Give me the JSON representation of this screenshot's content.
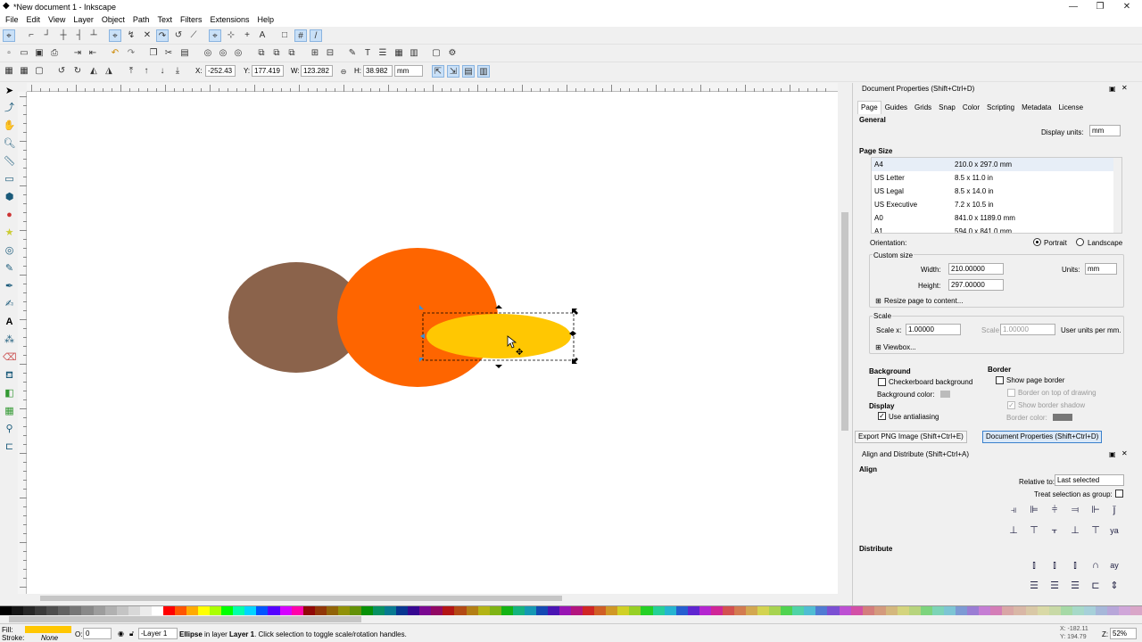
{
  "window": {
    "title": "*New document 1 - Inkscape",
    "minimize": "—",
    "maximize": "❐",
    "close": "✕"
  },
  "menu": [
    "File",
    "Edit",
    "View",
    "Layer",
    "Object",
    "Path",
    "Text",
    "Filters",
    "Extensions",
    "Help"
  ],
  "toolbar": {
    "x_label": "X:",
    "x_value": "-252.43",
    "y_label": "Y:",
    "y_value": "177.419",
    "w_label": "W:",
    "w_value": "123.282",
    "h_label": "H:",
    "h_value": "38.982",
    "unit": "mm"
  },
  "docprops": {
    "title": "Document Properties (Shift+Ctrl+D)",
    "tabs": [
      "Page",
      "Guides",
      "Grids",
      "Snap",
      "Color",
      "Scripting",
      "Metadata",
      "License"
    ],
    "general": "General",
    "display_units_label": "Display units:",
    "display_units": "mm",
    "page_size": "Page Size",
    "sizes": [
      {
        "name": "A4",
        "dim": "210.0 x 297.0 mm"
      },
      {
        "name": "US Letter",
        "dim": "8.5 x 11.0 in"
      },
      {
        "name": "US Legal",
        "dim": "8.5 x 14.0 in"
      },
      {
        "name": "US Executive",
        "dim": "7.2 x 10.5 in"
      },
      {
        "name": "A0",
        "dim": "841.0 x 1189.0 mm"
      },
      {
        "name": "A1",
        "dim": "594.0 x 841.0 mm"
      }
    ],
    "orientation_label": "Orientation:",
    "portrait": "Portrait",
    "landscape": "Landscape",
    "custom_size": "Custom size",
    "width_label": "Width:",
    "width": "210.00000",
    "height_label": "Height:",
    "height": "297.00000",
    "units_label": "Units:",
    "units": "mm",
    "resize": "Resize page to content...",
    "scale": "Scale",
    "scale_x_label": "Scale x:",
    "scale_x": "1.00000",
    "scale_y_label": "Scale y:",
    "scale_y": "1.00000",
    "user_units": "User units per mm.",
    "viewbox": "Viewbox...",
    "background": "Background",
    "checkerboard": "Checkerboard background",
    "bg_color_label": "Background color:",
    "border": "Border",
    "show_border": "Show page border",
    "border_top": "Border on top of drawing",
    "border_shadow": "Show border shadow",
    "border_color_label": "Border color:",
    "display": "Display",
    "antialias": "Use antialiasing"
  },
  "docks": {
    "export": "Export PNG Image (Shift+Ctrl+E)",
    "docprops": "Document Properties (Shift+Ctrl+D)"
  },
  "align": {
    "title": "Align and Distribute (Shift+Ctrl+A)",
    "align": "Align",
    "relative_label": "Relative to:",
    "relative": "Last selected",
    "treat_group": "Treat selection as group:",
    "distribute": "Distribute"
  },
  "status": {
    "fill_label": "Fill:",
    "stroke_label": "Stroke:",
    "stroke_value": "None",
    "opacity_label": "O:",
    "opacity": "0",
    "layer": "-Layer 1",
    "message_bold": "Ellipse",
    "message_mid": " in layer ",
    "message_layer": "Layer 1",
    "message_rest": ". Click selection to toggle scale/rotation handles.",
    "coords_x": "X: -182.11",
    "coords_y": "Y: 194.79",
    "zoom_label": "Z:",
    "zoom": "52%"
  },
  "colors": {
    "brown": "#8b634b",
    "orange": "#fe6500",
    "yellow": "#ffc702",
    "accent": "#3a80cc",
    "fill_swatch": "#ffc702"
  }
}
